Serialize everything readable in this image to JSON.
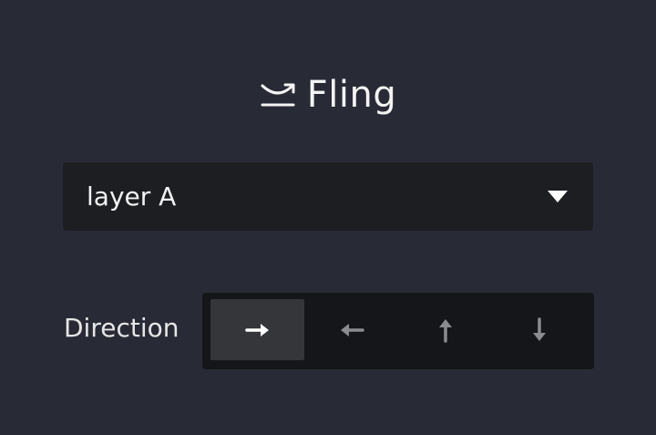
{
  "panel": {
    "title": "Fling",
    "title_icon": "fling-icon"
  },
  "layer_select": {
    "value": "layer A",
    "icon": "caret-down-icon"
  },
  "direction": {
    "label": "Direction",
    "options": [
      {
        "name": "right",
        "icon": "arrow-right-icon",
        "selected": true
      },
      {
        "name": "left",
        "icon": "arrow-left-icon",
        "selected": false
      },
      {
        "name": "up",
        "icon": "arrow-up-icon",
        "selected": false
      },
      {
        "name": "down",
        "icon": "arrow-down-icon",
        "selected": false
      }
    ]
  },
  "colors": {
    "background": "#282a36",
    "field_bg": "#1c1e22",
    "segment_bg": "#151619",
    "segment_active": "#35363a",
    "icon_active": "#ffffff",
    "icon_inactive": "#8a8b8e"
  }
}
